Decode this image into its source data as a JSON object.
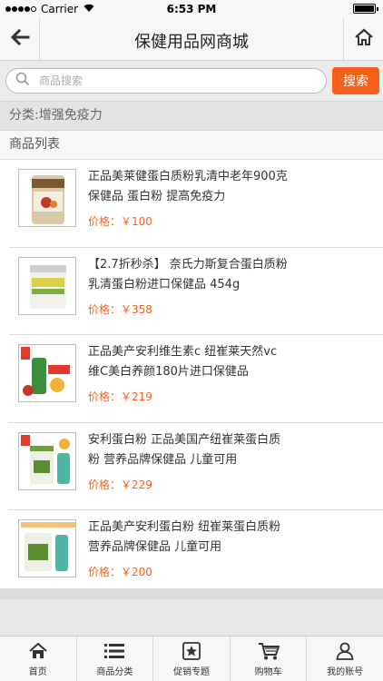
{
  "status_bar": {
    "carrier": "Carrier",
    "time": "6:53 PM"
  },
  "nav": {
    "title": "保健用品网商城",
    "back_icon": "arrow-left-icon",
    "home_icon": "home-icon"
  },
  "search": {
    "placeholder": "商品搜索",
    "button_label": "搜索"
  },
  "category": {
    "text": "分类:增强免疫力"
  },
  "list_header": "商品列表",
  "price_label": "价格：",
  "products": [
    {
      "name": "正品美莱健蛋白质粉乳清中老年900克 保健品 蛋白粉 提高免疫力",
      "price": "￥100"
    },
    {
      "name": "【2.7折秒杀】 奈氏力斯复合蛋白质粉 乳清蛋白粉进口保健品 454g",
      "price": "￥358"
    },
    {
      "name": "正品美产安利维生素c 纽崔莱天然vc维C美白养颜180片进口保健品",
      "price": "￥219"
    },
    {
      "name": "安利蛋白粉 正品美国产纽崔莱蛋白质粉 营养品牌保健品 儿童可用",
      "price": "￥229"
    },
    {
      "name": "正品美产安利蛋白粉 纽崔莱蛋白质粉 营养品牌保健品 儿童可用",
      "price": "￥200"
    }
  ],
  "tabs": [
    {
      "label": "首页",
      "icon": "home-icon"
    },
    {
      "label": "商品分类",
      "icon": "list-icon"
    },
    {
      "label": "促销专题",
      "icon": "star-icon"
    },
    {
      "label": "购物车",
      "icon": "cart-icon"
    },
    {
      "label": "我的账号",
      "icon": "user-icon"
    }
  ],
  "colors": {
    "accent": "#f5601d",
    "bar_bg": "#f7f7f7"
  }
}
